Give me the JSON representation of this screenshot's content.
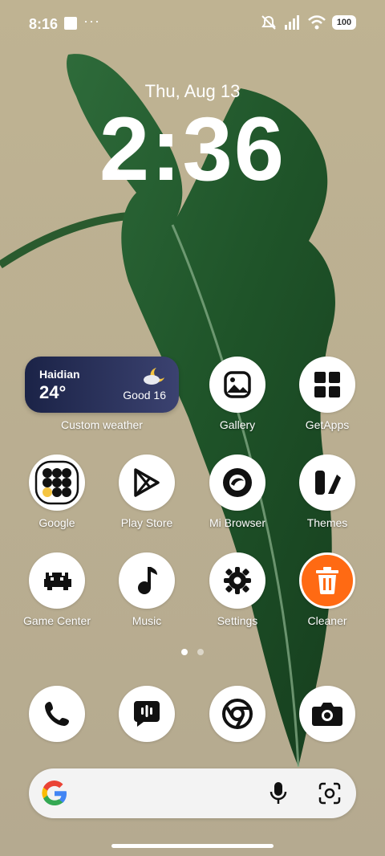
{
  "status_bar": {
    "time": "8:16",
    "more": "···",
    "battery": "100"
  },
  "lock": {
    "date": "Thu, Aug 13",
    "clock": "2:36"
  },
  "weather_widget": {
    "city": "Haidian",
    "temperature": "24°",
    "air_quality": "Good 16",
    "label": "Custom weather"
  },
  "apps": {
    "gallery": "Gallery",
    "getapps": "GetApps",
    "google": "Google",
    "play_store": "Play Store",
    "mi_browser": "Mi Browser",
    "themes": "Themes",
    "game_center": "Game Center",
    "music": "Music",
    "settings": "Settings",
    "cleaner": "Cleaner"
  },
  "page_indicator": {
    "pages": 2,
    "current": 1
  },
  "dock": [
    "phone-icon",
    "messages-icon",
    "chrome-icon",
    "camera-icon"
  ],
  "colors": {
    "cleaner_accent": "#ff6a13",
    "icon_dark": "#111111",
    "weather_bg": "#1b2347"
  }
}
